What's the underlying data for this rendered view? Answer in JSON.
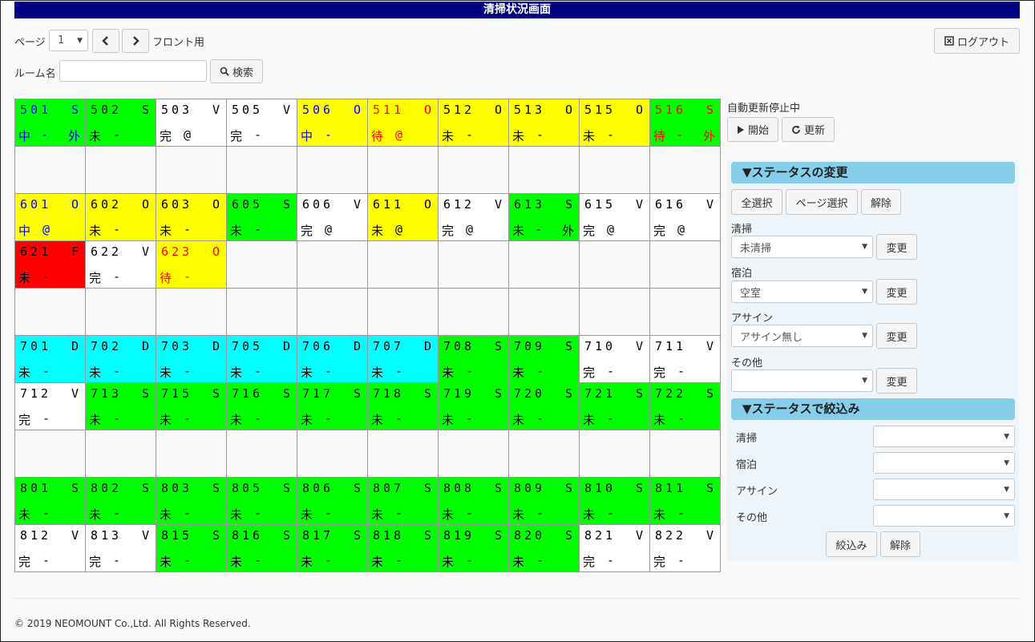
{
  "title": "清掃状況画面",
  "paging": {
    "label": "ページ",
    "page_value": "1",
    "prev_icon": "chevron-left-icon",
    "next_icon": "chevron-right-icon",
    "mode_label": "フロント用"
  },
  "search": {
    "label": "ルーム名",
    "value": "",
    "button_label": "検索"
  },
  "logout": {
    "label": "ログアウト"
  },
  "auto_update": {
    "status": "自動更新停止中",
    "start_label": "開始",
    "refresh_label": "更新"
  },
  "status_change": {
    "header": "▼ステータスの変更",
    "select_all": "全選択",
    "select_page": "ページ選択",
    "clear": "解除",
    "cleaning_label": "清掃",
    "cleaning_value": "未清掃",
    "stay_label": "宿泊",
    "stay_value": "空室",
    "assign_label": "アサイン",
    "assign_value": "アサイン無し",
    "other_label": "その他",
    "other_value": "",
    "change_label": "変更"
  },
  "filter": {
    "header": "▼ステータスで絞込み",
    "cleaning_label": "清掃",
    "stay_label": "宿泊",
    "assign_label": "アサイン",
    "other_label": "その他",
    "cleaning_value": "",
    "stay_value": "",
    "assign_value": "",
    "other_value": "",
    "apply_label": "絞込み",
    "clear_label": "解除"
  },
  "colors": {
    "green": "#00ff00",
    "yellow": "#ffff00",
    "cyan": "#00ffff",
    "red": "#ff0000",
    "white": "#ffffff",
    "blue_text": "#0000ff",
    "red_text": "#ff0000"
  },
  "grid": [
    [
      {
        "room": "501",
        "s": "S",
        "a": "中",
        "b": "-",
        "c": "外",
        "bg": "#00ff00",
        "fg": "#0000ff"
      },
      {
        "room": "502",
        "s": "S",
        "a": "未",
        "b": "-",
        "c": "",
        "bg": "#00ff00",
        "fg": "#000000"
      },
      {
        "room": "503",
        "s": "V",
        "a": "完",
        "b": "@",
        "c": "",
        "bg": "#ffffff",
        "fg": "#000000"
      },
      {
        "room": "505",
        "s": "V",
        "a": "完",
        "b": "-",
        "c": "",
        "bg": "#ffffff",
        "fg": "#000000"
      },
      {
        "room": "506",
        "s": "O",
        "a": "中",
        "b": "-",
        "c": "",
        "bg": "#ffff00",
        "fg": "#0000ff"
      },
      {
        "room": "511",
        "s": "O",
        "a": "待",
        "b": "@",
        "c": "",
        "bg": "#ffff00",
        "fg": "#ff0000"
      },
      {
        "room": "512",
        "s": "O",
        "a": "未",
        "b": "-",
        "c": "",
        "bg": "#ffff00",
        "fg": "#000000"
      },
      {
        "room": "513",
        "s": "O",
        "a": "未",
        "b": "-",
        "c": "",
        "bg": "#ffff00",
        "fg": "#000000"
      },
      {
        "room": "515",
        "s": "O",
        "a": "未",
        "b": "-",
        "c": "",
        "bg": "#ffff00",
        "fg": "#000000"
      },
      {
        "room": "516",
        "s": "S",
        "a": "待",
        "b": "-",
        "c": "外",
        "bg": "#00ff00",
        "fg": "#ff0000"
      }
    ],
    [
      null,
      null,
      null,
      null,
      null,
      null,
      null,
      null,
      null,
      null
    ],
    [
      {
        "room": "601",
        "s": "O",
        "a": "中",
        "b": "@",
        "c": "",
        "bg": "#ffff00",
        "fg": "#0000ff"
      },
      {
        "room": "602",
        "s": "O",
        "a": "未",
        "b": "-",
        "c": "",
        "bg": "#ffff00",
        "fg": "#000000"
      },
      {
        "room": "603",
        "s": "O",
        "a": "未",
        "b": "-",
        "c": "",
        "bg": "#ffff00",
        "fg": "#000000"
      },
      {
        "room": "605",
        "s": "S",
        "a": "未",
        "b": "-",
        "c": "",
        "bg": "#00ff00",
        "fg": "#000000"
      },
      {
        "room": "606",
        "s": "V",
        "a": "完",
        "b": "@",
        "c": "",
        "bg": "#ffffff",
        "fg": "#000000"
      },
      {
        "room": "611",
        "s": "O",
        "a": "未",
        "b": "@",
        "c": "",
        "bg": "#ffff00",
        "fg": "#000000"
      },
      {
        "room": "612",
        "s": "V",
        "a": "完",
        "b": "@",
        "c": "",
        "bg": "#ffffff",
        "fg": "#000000"
      },
      {
        "room": "613",
        "s": "S",
        "a": "未",
        "b": "-",
        "c": "外",
        "bg": "#00ff00",
        "fg": "#000000"
      },
      {
        "room": "615",
        "s": "V",
        "a": "完",
        "b": "@",
        "c": "",
        "bg": "#ffffff",
        "fg": "#000000"
      },
      {
        "room": "616",
        "s": "V",
        "a": "完",
        "b": "@",
        "c": "",
        "bg": "#ffffff",
        "fg": "#000000"
      }
    ],
    [
      {
        "room": "621",
        "s": "F",
        "a": "未",
        "b": "-",
        "c": "",
        "bg": "#ff0000",
        "fg": "#000000"
      },
      {
        "room": "622",
        "s": "V",
        "a": "完",
        "b": "-",
        "c": "",
        "bg": "#ffffff",
        "fg": "#000000"
      },
      {
        "room": "623",
        "s": "O",
        "a": "待",
        "b": "-",
        "c": "",
        "bg": "#ffff00",
        "fg": "#ff0000"
      },
      null,
      null,
      null,
      null,
      null,
      null,
      null
    ],
    [
      null,
      null,
      null,
      null,
      null,
      null,
      null,
      null,
      null,
      null
    ],
    [
      {
        "room": "701",
        "s": "D",
        "a": "未",
        "b": "-",
        "c": "",
        "bg": "#00ffff",
        "fg": "#000000"
      },
      {
        "room": "702",
        "s": "D",
        "a": "未",
        "b": "-",
        "c": "",
        "bg": "#00ffff",
        "fg": "#000000"
      },
      {
        "room": "703",
        "s": "D",
        "a": "未",
        "b": "-",
        "c": "",
        "bg": "#00ffff",
        "fg": "#000000"
      },
      {
        "room": "705",
        "s": "D",
        "a": "未",
        "b": "-",
        "c": "",
        "bg": "#00ffff",
        "fg": "#000000"
      },
      {
        "room": "706",
        "s": "D",
        "a": "未",
        "b": "-",
        "c": "",
        "bg": "#00ffff",
        "fg": "#000000"
      },
      {
        "room": "707",
        "s": "D",
        "a": "未",
        "b": "-",
        "c": "",
        "bg": "#00ffff",
        "fg": "#000000"
      },
      {
        "room": "708",
        "s": "S",
        "a": "未",
        "b": "-",
        "c": "",
        "bg": "#00ff00",
        "fg": "#000000"
      },
      {
        "room": "709",
        "s": "S",
        "a": "未",
        "b": "-",
        "c": "",
        "bg": "#00ff00",
        "fg": "#000000"
      },
      {
        "room": "710",
        "s": "V",
        "a": "完",
        "b": "-",
        "c": "",
        "bg": "#ffffff",
        "fg": "#000000"
      },
      {
        "room": "711",
        "s": "V",
        "a": "完",
        "b": "-",
        "c": "",
        "bg": "#ffffff",
        "fg": "#000000"
      }
    ],
    [
      {
        "room": "712",
        "s": "V",
        "a": "完",
        "b": "-",
        "c": "",
        "bg": "#ffffff",
        "fg": "#000000"
      },
      {
        "room": "713",
        "s": "S",
        "a": "未",
        "b": "-",
        "c": "",
        "bg": "#00ff00",
        "fg": "#000000"
      },
      {
        "room": "715",
        "s": "S",
        "a": "未",
        "b": "-",
        "c": "",
        "bg": "#00ff00",
        "fg": "#000000"
      },
      {
        "room": "716",
        "s": "S",
        "a": "未",
        "b": "-",
        "c": "",
        "bg": "#00ff00",
        "fg": "#000000"
      },
      {
        "room": "717",
        "s": "S",
        "a": "未",
        "b": "-",
        "c": "",
        "bg": "#00ff00",
        "fg": "#000000"
      },
      {
        "room": "718",
        "s": "S",
        "a": "未",
        "b": "-",
        "c": "",
        "bg": "#00ff00",
        "fg": "#000000"
      },
      {
        "room": "719",
        "s": "S",
        "a": "未",
        "b": "-",
        "c": "",
        "bg": "#00ff00",
        "fg": "#000000"
      },
      {
        "room": "720",
        "s": "S",
        "a": "未",
        "b": "-",
        "c": "",
        "bg": "#00ff00",
        "fg": "#000000"
      },
      {
        "room": "721",
        "s": "S",
        "a": "未",
        "b": "-",
        "c": "",
        "bg": "#00ff00",
        "fg": "#000000"
      },
      {
        "room": "722",
        "s": "S",
        "a": "未",
        "b": "-",
        "c": "",
        "bg": "#00ff00",
        "fg": "#000000"
      }
    ],
    [
      null,
      null,
      null,
      null,
      null,
      null,
      null,
      null,
      null,
      null
    ],
    [
      {
        "room": "801",
        "s": "S",
        "a": "未",
        "b": "-",
        "c": "",
        "bg": "#00ff00",
        "fg": "#000000"
      },
      {
        "room": "802",
        "s": "S",
        "a": "未",
        "b": "-",
        "c": "",
        "bg": "#00ff00",
        "fg": "#000000"
      },
      {
        "room": "803",
        "s": "S",
        "a": "未",
        "b": "-",
        "c": "",
        "bg": "#00ff00",
        "fg": "#000000"
      },
      {
        "room": "805",
        "s": "S",
        "a": "未",
        "b": "-",
        "c": "",
        "bg": "#00ff00",
        "fg": "#000000"
      },
      {
        "room": "806",
        "s": "S",
        "a": "未",
        "b": "-",
        "c": "",
        "bg": "#00ff00",
        "fg": "#000000"
      },
      {
        "room": "807",
        "s": "S",
        "a": "未",
        "b": "-",
        "c": "",
        "bg": "#00ff00",
        "fg": "#000000"
      },
      {
        "room": "808",
        "s": "S",
        "a": "未",
        "b": "-",
        "c": "",
        "bg": "#00ff00",
        "fg": "#000000"
      },
      {
        "room": "809",
        "s": "S",
        "a": "未",
        "b": "-",
        "c": "",
        "bg": "#00ff00",
        "fg": "#000000"
      },
      {
        "room": "810",
        "s": "S",
        "a": "未",
        "b": "-",
        "c": "",
        "bg": "#00ff00",
        "fg": "#000000"
      },
      {
        "room": "811",
        "s": "S",
        "a": "未",
        "b": "-",
        "c": "",
        "bg": "#00ff00",
        "fg": "#000000"
      }
    ],
    [
      {
        "room": "812",
        "s": "V",
        "a": "完",
        "b": "-",
        "c": "",
        "bg": "#ffffff",
        "fg": "#000000"
      },
      {
        "room": "813",
        "s": "V",
        "a": "完",
        "b": "-",
        "c": "",
        "bg": "#ffffff",
        "fg": "#000000"
      },
      {
        "room": "815",
        "s": "S",
        "a": "未",
        "b": "-",
        "c": "",
        "bg": "#00ff00",
        "fg": "#000000"
      },
      {
        "room": "816",
        "s": "S",
        "a": "未",
        "b": "-",
        "c": "",
        "bg": "#00ff00",
        "fg": "#000000"
      },
      {
        "room": "817",
        "s": "S",
        "a": "未",
        "b": "-",
        "c": "",
        "bg": "#00ff00",
        "fg": "#000000"
      },
      {
        "room": "818",
        "s": "S",
        "a": "未",
        "b": "-",
        "c": "",
        "bg": "#00ff00",
        "fg": "#000000"
      },
      {
        "room": "819",
        "s": "S",
        "a": "未",
        "b": "-",
        "c": "",
        "bg": "#00ff00",
        "fg": "#000000"
      },
      {
        "room": "820",
        "s": "S",
        "a": "未",
        "b": "-",
        "c": "",
        "bg": "#00ff00",
        "fg": "#000000"
      },
      {
        "room": "821",
        "s": "V",
        "a": "完",
        "b": "-",
        "c": "",
        "bg": "#ffffff",
        "fg": "#000000"
      },
      {
        "room": "822",
        "s": "V",
        "a": "完",
        "b": "-",
        "c": "",
        "bg": "#ffffff",
        "fg": "#000000"
      }
    ]
  ],
  "footer": "© 2019 NEOMOUNT Co.,Ltd. All Rights Reserved."
}
